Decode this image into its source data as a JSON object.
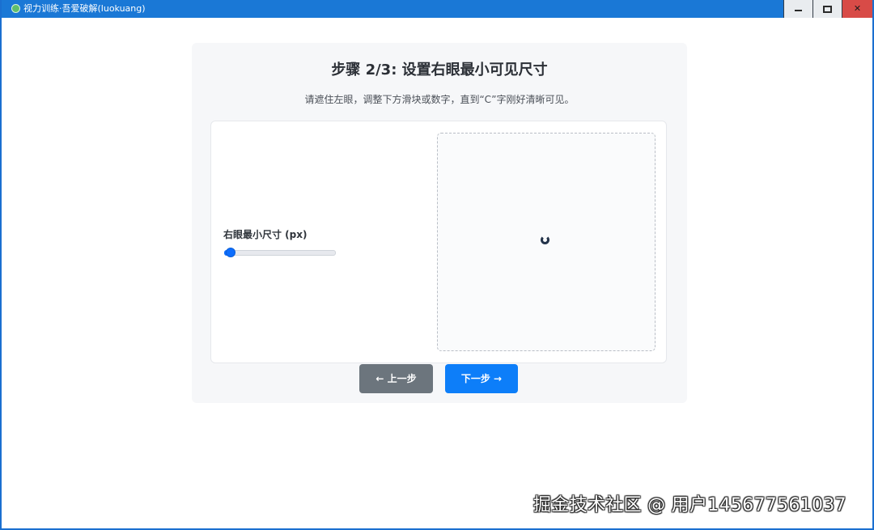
{
  "window": {
    "title": "视力训练·吾爱破解(luokuang)",
    "controls": {
      "minimize_icon": "minimize-icon",
      "maximize_icon": "maximize-icon",
      "close_icon": "close-icon",
      "close_glyph": "✕"
    }
  },
  "step": {
    "title": "步骤 2/3: 设置右眼最小可见尺寸",
    "instruction": "请遮住左眼，调整下方滑块或数字，直到“C”字刚好清晰可见。"
  },
  "control": {
    "label": "右眼最小尺寸 (px)",
    "slider_fraction": 0.06
  },
  "preview": {
    "state_icon": "loading-spinner-icon"
  },
  "buttons": {
    "prev": "← 上一步",
    "next": "下一步 →"
  },
  "watermark": "掘金技术社区 @ 用户145677561037",
  "colors": {
    "titlebar": "#1a78d6",
    "primary": "#0d7ef9",
    "secondary": "#6c757d",
    "close": "#d84b47"
  }
}
